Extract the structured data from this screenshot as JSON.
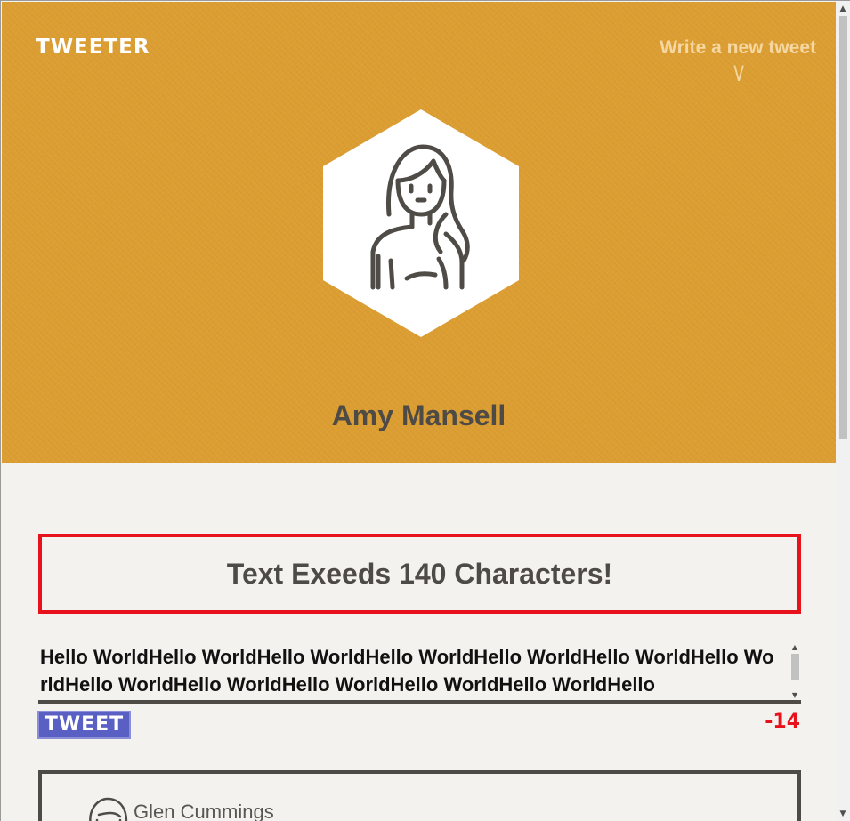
{
  "header": {
    "logo": "TWEETER",
    "compose_link": "Write a new tweet",
    "compose_arrow": "\\/"
  },
  "profile": {
    "name": "Amy Mansell",
    "avatar_icon": "woman-avatar-icon"
  },
  "error": {
    "message": "Text Exeeds 140 Characters!"
  },
  "composer": {
    "text": "Hello WorldHello WorldHello WorldHello WorldHello WorldHello WorldHello WorldHello WorldHello WorldHello WorldHello WorldHello WorldHello",
    "button_label": "TWEET",
    "char_count": "-14"
  },
  "feed": {
    "tweets": [
      {
        "author": "Glen Cummings"
      }
    ]
  },
  "colors": {
    "banner": "#dc9e32",
    "accent": "#5a5fc4",
    "error": "#e8121c",
    "text_dark": "#4e4a45"
  }
}
